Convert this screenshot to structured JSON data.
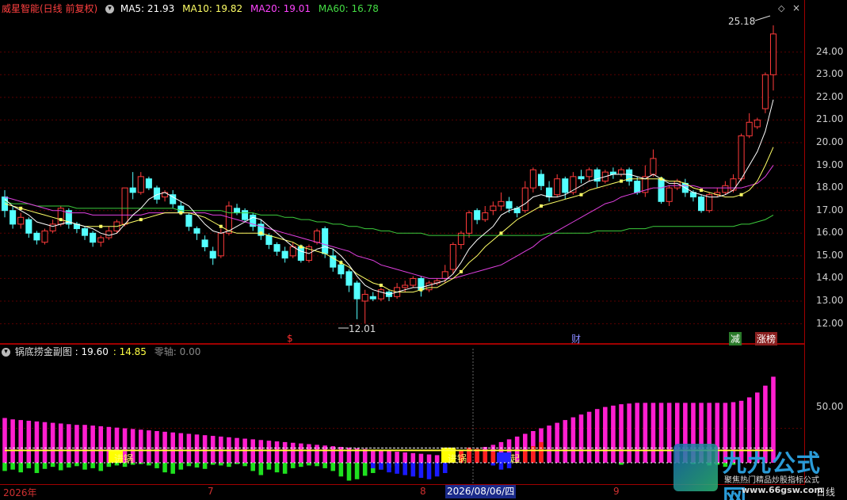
{
  "main_panel": {
    "title": "威星智能(日线 前复权)",
    "ma": [
      {
        "label": "MA5: 21.93",
        "color": "#ffffff"
      },
      {
        "label": "MA10: 19.82",
        "color": "#ffff66"
      },
      {
        "label": "MA20: 19.01",
        "color": "#ff44ff"
      },
      {
        "label": "MA60: 16.78",
        "color": "#44dd44"
      }
    ],
    "y_ticks": [
      "24.00",
      "23.00",
      "22.00",
      "21.00",
      "20.00",
      "19.00",
      "18.00",
      "17.00",
      "16.00",
      "15.00",
      "14.00",
      "13.00",
      "12.00"
    ],
    "high_annotation": "25.18",
    "low_annotation": "12.01",
    "event_markers": [
      {
        "text": "$",
        "color": "#ff3030"
      },
      {
        "text": "财",
        "color": "#8888ff"
      },
      {
        "text": "减",
        "color": "#ffffff",
        "bg": "#2a7a2a"
      },
      {
        "text": "涨榜",
        "color": "#ffffff",
        "bg": "#8a2020"
      }
    ]
  },
  "sub_panel": {
    "title": "锅底捞金副图",
    "value1": ": 19.60",
    "value2": ": 14.85",
    "zero_label": "零轴: 0.00",
    "y_tick": "50.00",
    "signals": [
      "进锅",
      "进锅",
      "起"
    ]
  },
  "x_axis": {
    "labels": [
      "2026年",
      "7",
      "8",
      "2026/08/06/四",
      "9"
    ],
    "period": "日线"
  },
  "watermark": {
    "main": "九九公式网",
    "sub": "聚焦热门精品炒股指标公式",
    "url": "www.66gsw.com"
  },
  "chart_data": {
    "type": "candlestick",
    "ylim": [
      11.6,
      25.6
    ],
    "candles": [
      [
        17.6,
        17.0,
        17.9,
        16.7
      ],
      [
        17.0,
        16.4,
        17.2,
        16.2
      ],
      [
        16.4,
        16.7,
        16.9,
        16.2
      ],
      [
        16.6,
        16.0,
        16.7,
        15.8
      ],
      [
        16.0,
        15.7,
        16.1,
        15.5
      ],
      [
        15.6,
        16.1,
        16.2,
        15.5
      ],
      [
        16.1,
        16.4,
        16.6,
        16.0
      ],
      [
        16.4,
        17.1,
        17.2,
        16.3
      ],
      [
        17.0,
        16.4,
        17.1,
        16.2
      ],
      [
        16.4,
        16.2,
        16.5,
        16.0
      ],
      [
        16.2,
        15.9,
        16.3,
        15.7
      ],
      [
        16.0,
        15.6,
        16.1,
        15.4
      ],
      [
        15.6,
        15.8,
        15.9,
        15.4
      ],
      [
        15.8,
        16.1,
        16.3,
        15.7
      ],
      [
        16.1,
        16.5,
        16.6,
        16.0
      ],
      [
        16.4,
        18.0,
        18.0,
        16.3
      ],
      [
        18.0,
        17.8,
        18.7,
        17.5
      ],
      [
        17.8,
        18.5,
        18.7,
        17.7
      ],
      [
        18.4,
        18.0,
        18.5,
        17.9
      ],
      [
        18.0,
        17.5,
        18.1,
        17.3
      ],
      [
        17.6,
        17.8,
        17.9,
        17.4
      ],
      [
        17.7,
        17.3,
        17.9,
        17.1
      ],
      [
        17.2,
        16.9,
        17.4,
        16.8
      ],
      [
        16.8,
        16.3,
        16.9,
        16.1
      ],
      [
        16.2,
        16.0,
        16.3,
        15.7
      ],
      [
        15.7,
        15.4,
        15.9,
        15.2
      ],
      [
        15.2,
        14.9,
        15.4,
        14.6
      ],
      [
        15.0,
        16.0,
        16.2,
        14.9
      ],
      [
        16.0,
        17.2,
        17.4,
        15.9
      ],
      [
        17.1,
        16.9,
        17.3,
        16.8
      ],
      [
        17.0,
        16.6,
        17.1,
        16.5
      ],
      [
        16.8,
        16.3,
        16.9,
        16.1
      ],
      [
        16.4,
        15.9,
        16.6,
        15.7
      ],
      [
        15.9,
        15.5,
        16.0,
        15.3
      ],
      [
        15.5,
        15.2,
        15.6,
        15.0
      ],
      [
        15.2,
        14.9,
        15.4,
        14.7
      ],
      [
        15.0,
        15.4,
        15.6,
        14.9
      ],
      [
        15.4,
        14.8,
        15.5,
        14.7
      ],
      [
        14.8,
        15.4,
        15.5,
        14.7
      ],
      [
        15.6,
        16.1,
        16.2,
        15.5
      ],
      [
        16.2,
        15.1,
        16.3,
        14.9
      ],
      [
        15.0,
        14.5,
        15.3,
        14.3
      ],
      [
        14.6,
        14.2,
        14.8,
        14.0
      ],
      [
        14.3,
        13.7,
        14.4,
        13.4
      ],
      [
        13.8,
        13.1,
        13.9,
        12.2
      ],
      [
        13.0,
        13.3,
        13.5,
        12.01
      ],
      [
        13.2,
        13.1,
        13.4,
        13.0
      ],
      [
        13.1,
        13.5,
        13.6,
        13.0
      ],
      [
        13.4,
        13.2,
        13.5,
        13.0
      ],
      [
        13.2,
        13.6,
        13.8,
        13.1
      ],
      [
        13.6,
        13.7,
        13.9,
        13.4
      ],
      [
        13.7,
        14.0,
        14.1,
        13.6
      ],
      [
        14.0,
        13.5,
        14.1,
        13.2
      ],
      [
        13.5,
        13.8,
        13.9,
        13.4
      ],
      [
        13.8,
        13.9,
        14.0,
        13.7
      ],
      [
        14.0,
        14.3,
        14.6,
        13.8
      ],
      [
        14.4,
        15.5,
        15.6,
        14.2
      ],
      [
        15.5,
        16.0,
        16.1,
        15.3
      ],
      [
        16.0,
        16.9,
        17.0,
        15.8
      ],
      [
        17.0,
        16.6,
        17.1,
        16.4
      ],
      [
        16.6,
        16.9,
        17.2,
        16.5
      ],
      [
        17.0,
        17.2,
        17.4,
        16.8
      ],
      [
        17.2,
        17.4,
        17.8,
        17.0
      ],
      [
        17.4,
        17.1,
        17.6,
        16.9
      ],
      [
        17.1,
        16.9,
        17.2,
        16.7
      ],
      [
        17.0,
        18.0,
        18.3,
        16.9
      ],
      [
        18.0,
        18.8,
        18.9,
        17.8
      ],
      [
        18.6,
        18.1,
        18.8,
        17.9
      ],
      [
        18.0,
        17.6,
        18.3,
        17.4
      ],
      [
        17.7,
        18.4,
        18.6,
        17.6
      ],
      [
        18.4,
        17.8,
        18.5,
        17.5
      ],
      [
        17.8,
        18.5,
        18.7,
        17.7
      ],
      [
        18.5,
        18.4,
        18.8,
        18.2
      ],
      [
        18.5,
        18.8,
        18.9,
        18.3
      ],
      [
        18.8,
        18.3,
        18.9,
        18.0
      ],
      [
        18.3,
        18.7,
        18.8,
        18.2
      ],
      [
        18.7,
        18.6,
        18.9,
        18.4
      ],
      [
        18.6,
        18.8,
        18.9,
        18.5
      ],
      [
        18.8,
        18.3,
        18.9,
        18.1
      ],
      [
        18.3,
        17.8,
        18.5,
        17.7
      ],
      [
        17.8,
        18.5,
        19.0,
        17.6
      ],
      [
        18.6,
        19.3,
        19.7,
        18.5
      ],
      [
        18.4,
        17.4,
        18.5,
        17.3
      ],
      [
        17.4,
        18.0,
        18.1,
        17.2
      ],
      [
        18.0,
        18.3,
        18.4,
        17.9
      ],
      [
        18.2,
        17.8,
        18.4,
        17.6
      ],
      [
        17.8,
        17.6,
        17.9,
        17.4
      ],
      [
        17.6,
        17.0,
        17.7,
        16.9
      ],
      [
        17.0,
        17.7,
        17.8,
        16.9
      ],
      [
        17.7,
        17.8,
        18.0,
        17.6
      ],
      [
        17.8,
        18.1,
        18.3,
        17.7
      ],
      [
        17.9,
        18.4,
        18.6,
        17.8
      ],
      [
        18.4,
        20.3,
        20.4,
        18.3
      ],
      [
        20.3,
        20.9,
        21.3,
        20.2
      ],
      [
        20.7,
        21.0,
        21.1,
        20.6
      ],
      [
        21.5,
        23.0,
        23.1,
        21.3
      ],
      [
        23.0,
        24.8,
        25.18,
        22.3
      ]
    ],
    "ma5": [
      17.5,
      17.2,
      17.0,
      16.8,
      16.5,
      16.4,
      16.3,
      16.4,
      16.5,
      16.4,
      16.3,
      16.2,
      16.0,
      15.9,
      16.0,
      16.4,
      16.8,
      17.1,
      17.5,
      17.7,
      17.8,
      17.6,
      17.4,
      17.2,
      16.8,
      16.4,
      16.1,
      16.0,
      16.1,
      16.3,
      16.5,
      16.7,
      16.6,
      16.3,
      16.0,
      15.7,
      15.4,
      15.2,
      15.1,
      15.3,
      15.4,
      15.3,
      15.0,
      14.6,
      14.1,
      13.7,
      13.5,
      13.4,
      13.3,
      13.4,
      13.5,
      13.6,
      13.6,
      13.7,
      13.8,
      13.9,
      14.2,
      14.7,
      15.3,
      15.7,
      16.0,
      16.3,
      16.8,
      17.0,
      17.1,
      17.3,
      17.6,
      17.7,
      17.6,
      17.6,
      17.7,
      17.9,
      18.1,
      18.3,
      18.4,
      18.5,
      18.6,
      18.6,
      18.6,
      18.5,
      18.4,
      18.6,
      18.4,
      18.2,
      18.2,
      18.0,
      17.8,
      17.7,
      17.6,
      17.6,
      17.7,
      17.9,
      18.4,
      19.0,
      19.6,
      20.5,
      21.9
    ],
    "ma10": [
      17.3,
      17.2,
      17.1,
      17.0,
      16.9,
      16.8,
      16.7,
      16.6,
      16.5,
      16.4,
      16.3,
      16.3,
      16.3,
      16.3,
      16.3,
      16.4,
      16.5,
      16.6,
      16.7,
      16.8,
      16.9,
      16.9,
      16.9,
      16.9,
      16.8,
      16.7,
      16.5,
      16.3,
      16.1,
      16.0,
      16.0,
      16.0,
      16.0,
      15.9,
      15.8,
      15.7,
      15.6,
      15.4,
      15.3,
      15.2,
      15.1,
      14.9,
      14.7,
      14.5,
      14.2,
      14.0,
      13.8,
      13.7,
      13.5,
      13.4,
      13.4,
      13.4,
      13.5,
      13.6,
      13.6,
      13.8,
      14.0,
      14.3,
      14.7,
      15.0,
      15.4,
      15.7,
      16.0,
      16.3,
      16.6,
      16.8,
      17.0,
      17.2,
      17.3,
      17.4,
      17.5,
      17.6,
      17.7,
      17.9,
      18.0,
      18.1,
      18.2,
      18.3,
      18.4,
      18.4,
      18.4,
      18.4,
      18.4,
      18.3,
      18.3,
      18.2,
      18.0,
      17.9,
      17.8,
      17.7,
      17.6,
      17.6,
      17.7,
      17.9,
      18.3,
      19.0,
      19.8
    ],
    "ma20": [
      17.6,
      17.5,
      17.4,
      17.3,
      17.2,
      17.1,
      17.0,
      17.0,
      16.9,
      16.9,
      16.9,
      16.8,
      16.8,
      16.8,
      16.8,
      16.8,
      16.8,
      16.8,
      16.9,
      16.9,
      16.9,
      16.9,
      16.9,
      16.9,
      16.9,
      16.9,
      16.8,
      16.8,
      16.7,
      16.6,
      16.5,
      16.4,
      16.3,
      16.2,
      16.1,
      16.0,
      15.9,
      15.8,
      15.7,
      15.6,
      15.5,
      15.4,
      15.3,
      15.2,
      15.0,
      14.9,
      14.8,
      14.6,
      14.5,
      14.4,
      14.3,
      14.2,
      14.1,
      14.0,
      14.0,
      14.0,
      14.0,
      14.1,
      14.2,
      14.3,
      14.4,
      14.5,
      14.6,
      14.8,
      15.0,
      15.2,
      15.4,
      15.7,
      15.9,
      16.1,
      16.3,
      16.5,
      16.7,
      16.9,
      17.1,
      17.3,
      17.4,
      17.6,
      17.7,
      17.8,
      17.9,
      18.0,
      18.0,
      18.1,
      18.1,
      18.1,
      18.1,
      18.0,
      18.0,
      18.0,
      18.0,
      18.0,
      18.0,
      18.1,
      18.2,
      18.5,
      19.0
    ],
    "ma60": [
      17.4,
      17.3,
      17.3,
      17.3,
      17.2,
      17.2,
      17.2,
      17.2,
      17.2,
      17.1,
      17.1,
      17.1,
      17.1,
      17.1,
      17.1,
      17.1,
      17.1,
      17.1,
      17.1,
      17.1,
      17.1,
      17.1,
      17.0,
      17.0,
      17.0,
      17.0,
      17.0,
      17.0,
      16.9,
      16.9,
      16.9,
      16.9,
      16.8,
      16.8,
      16.8,
      16.7,
      16.7,
      16.6,
      16.6,
      16.5,
      16.5,
      16.4,
      16.4,
      16.3,
      16.3,
      16.2,
      16.2,
      16.1,
      16.1,
      16.0,
      16.0,
      16.0,
      16.0,
      15.9,
      15.9,
      15.9,
      15.9,
      15.9,
      15.9,
      15.9,
      15.9,
      15.9,
      15.9,
      15.9,
      15.9,
      15.9,
      15.9,
      15.9,
      16.0,
      16.0,
      16.0,
      16.0,
      16.0,
      16.0,
      16.1,
      16.1,
      16.1,
      16.1,
      16.2,
      16.2,
      16.2,
      16.3,
      16.3,
      16.3,
      16.3,
      16.3,
      16.3,
      16.3,
      16.3,
      16.3,
      16.3,
      16.3,
      16.4,
      16.4,
      16.5,
      16.6,
      16.8
    ],
    "sub_ylim": [
      -30,
      160
    ],
    "sub_magenta": [
      65,
      63,
      62,
      61,
      60,
      59,
      58,
      57,
      56,
      55,
      55,
      54,
      53,
      52,
      51,
      50,
      49,
      48,
      47,
      46,
      45,
      44,
      43,
      42,
      41,
      40,
      39,
      38,
      37,
      36,
      35,
      34,
      33,
      32,
      31,
      30,
      29,
      28,
      27,
      26,
      25,
      24,
      23,
      22,
      21,
      20,
      19,
      18,
      17,
      16,
      15,
      14,
      13,
      12,
      11,
      12,
      14,
      16,
      18,
      20,
      23,
      26,
      30,
      34,
      38,
      42,
      46,
      50,
      54,
      58,
      62,
      66,
      70,
      74,
      78,
      81,
      83,
      85,
      86,
      87,
      87,
      87,
      87,
      87,
      87,
      87,
      87,
      87,
      87,
      87,
      87,
      88,
      90,
      95,
      102,
      112,
      125
    ],
    "sub_green": [
      -12,
      -10,
      -14,
      -8,
      -15,
      -9,
      -6,
      -11,
      -7,
      -5,
      -10,
      -8,
      -12,
      -6,
      -4,
      -6,
      -3,
      -2,
      -4,
      -8,
      -14,
      -16,
      -10,
      -5,
      -7,
      -9,
      -3,
      -4,
      -6,
      -2,
      -5,
      -12,
      -18,
      -10,
      -14,
      -16,
      -8,
      -6,
      -4,
      -5,
      -8,
      -12,
      -20,
      -26,
      -24,
      -19,
      -15,
      -10,
      -7,
      -5,
      -3,
      -2,
      -1,
      -1,
      -1,
      0,
      0,
      0,
      0,
      0,
      0,
      0,
      0,
      0,
      0,
      0,
      0,
      0,
      0,
      0,
      0,
      0,
      0,
      0,
      0,
      0,
      0,
      -3,
      0,
      0,
      0,
      0,
      0,
      0,
      0,
      0,
      -2,
      0,
      -4,
      -3,
      -6,
      -3,
      0,
      0,
      0,
      0,
      0
    ],
    "sub_blue": [
      0,
      0,
      0,
      0,
      0,
      0,
      0,
      0,
      0,
      0,
      0,
      0,
      0,
      0,
      0,
      0,
      0,
      0,
      0,
      0,
      0,
      0,
      0,
      0,
      0,
      0,
      0,
      0,
      0,
      0,
      0,
      0,
      0,
      0,
      0,
      0,
      0,
      0,
      0,
      0,
      0,
      0,
      0,
      0,
      0,
      0,
      -8,
      -10,
      -14,
      -16,
      -18,
      -20,
      -22,
      -24,
      -20,
      -15,
      0,
      0,
      0,
      0,
      0,
      -4,
      -10,
      -8,
      0,
      0,
      0,
      0,
      0,
      0,
      0,
      0,
      0,
      0,
      0,
      0,
      0,
      0,
      0,
      0,
      0,
      0,
      0,
      0,
      0,
      0,
      0,
      0,
      0,
      0,
      0,
      0,
      0,
      0,
      0,
      0,
      0
    ],
    "sub_red": [
      0,
      0,
      0,
      0,
      0,
      0,
      0,
      0,
      0,
      0,
      0,
      0,
      0,
      0,
      0,
      0,
      0,
      0,
      0,
      0,
      0,
      0,
      0,
      0,
      0,
      0,
      0,
      0,
      0,
      0,
      0,
      0,
      0,
      0,
      0,
      0,
      0,
      0,
      0,
      0,
      0,
      0,
      0,
      0,
      0,
      0,
      0,
      0,
      0,
      0,
      0,
      0,
      0,
      0,
      0,
      3,
      14,
      18,
      22,
      20,
      18,
      16,
      14,
      0,
      0,
      18,
      24,
      30,
      0,
      0,
      0,
      0,
      0,
      0,
      0,
      0,
      0,
      0,
      0,
      0,
      0,
      0,
      0,
      0,
      0,
      0,
      0,
      0,
      0,
      0,
      0,
      0,
      0,
      0,
      0,
      0,
      0
    ],
    "sub_yellow_line": 18
  }
}
